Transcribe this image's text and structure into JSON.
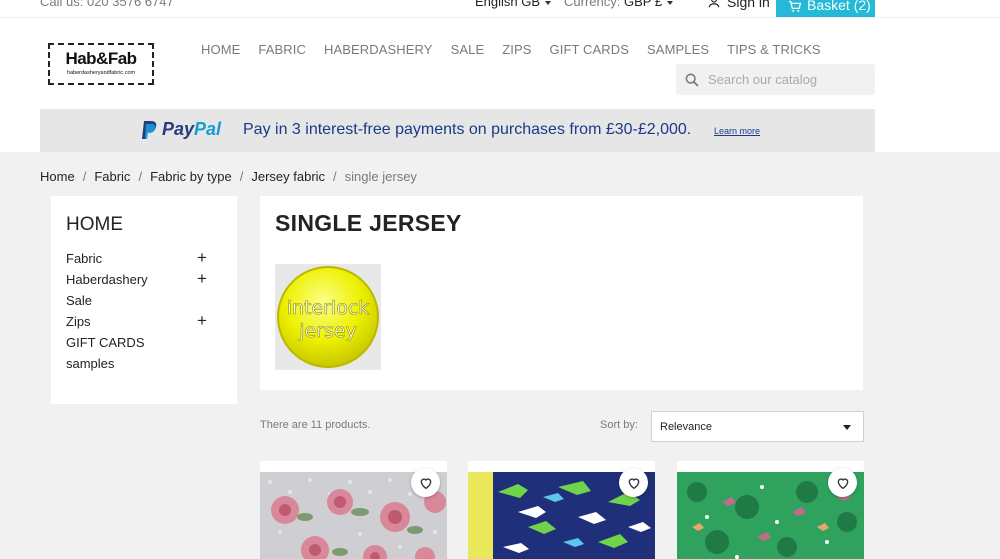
{
  "topbar": {
    "call_us": "Call us: 020 3576 6747",
    "language": "English GB",
    "currency_label": "Currency:",
    "currency_value": "GBP £",
    "sign_in": "Sign in",
    "basket": "Basket (2)"
  },
  "header": {
    "logo_big": "Hab&Fab",
    "logo_small": "haberdasheryandfabric.com",
    "menu": [
      "HOME",
      "FABRIC",
      "HABERDASHERY",
      "SALE",
      "ZIPS",
      "GIFT CARDS",
      "SAMPLES",
      "TIPS & TRICKS"
    ],
    "search_placeholder": "Search our catalog"
  },
  "paypal": {
    "pay": "Pay",
    "pal": "Pal",
    "message": "Pay in 3 interest-free payments on purchases from £30-£2,000.",
    "learn_more": "Learn more"
  },
  "breadcrumb": [
    "Home",
    "Fabric",
    "Fabric by type",
    "Jersey fabric",
    "single jersey"
  ],
  "sidebar": {
    "title": "HOME",
    "items": [
      {
        "label": "Fabric",
        "expandable": true
      },
      {
        "label": "Haberdashery",
        "expandable": true
      },
      {
        "label": "Sale",
        "expandable": false
      },
      {
        "label": "Zips",
        "expandable": true
      },
      {
        "label": "GIFT CARDS",
        "expandable": false
      },
      {
        "label": "samples",
        "expandable": false
      }
    ]
  },
  "category": {
    "title": "SINGLE JERSEY",
    "image_text_line1": "interlock",
    "image_text_line2": "jersey"
  },
  "listing": {
    "count_text": "There are 11 products.",
    "sort_label": "Sort by:",
    "sort_value": "Relevance"
  },
  "colors": {
    "accent": "#24b9d7",
    "paypal_dark": "#253b80",
    "paypal_light": "#179bd7"
  }
}
